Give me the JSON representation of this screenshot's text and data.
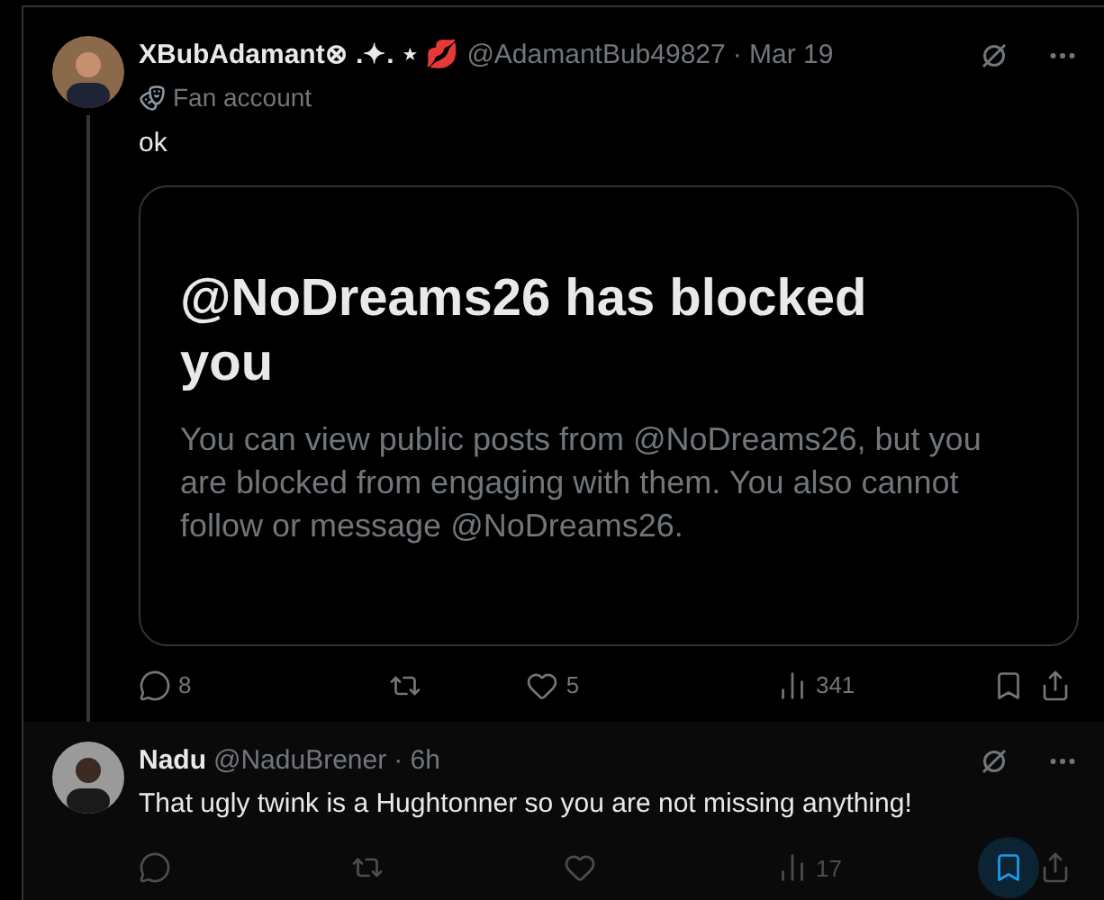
{
  "post": {
    "display_name": "XBubAdamant⊗ .✦. ⋆ 💋",
    "handle": "@AdamantBub49827",
    "time": "· Mar 19",
    "label": "Fan account",
    "text": "ok",
    "notice": {
      "title": "@NoDreams26 has blocked you",
      "body": "You can view public posts from @NoDreams26, but you are blocked from engaging with them. You also cannot follow or message @NoDreams26."
    },
    "actions": [
      {
        "kind": "reply",
        "count": "8",
        "highlighted": false
      },
      {
        "kind": "repost",
        "highlighted": false
      },
      {
        "kind": "like",
        "count": "5",
        "highlighted": false
      },
      {
        "kind": "views",
        "count": "341",
        "highlighted": false
      },
      {
        "kind": "bookmark",
        "highlighted": false
      },
      {
        "kind": "share",
        "highlighted": false
      }
    ]
  },
  "reply": {
    "display_name": "Nadu",
    "handle": "@NaduBrener",
    "time": "· 6h",
    "text": "That ugly twink is a Hughtonner so you are not missing anything!",
    "actions": [
      {
        "kind": "reply",
        "highlighted": false
      },
      {
        "kind": "repost",
        "highlighted": false
      },
      {
        "kind": "like",
        "highlighted": false
      },
      {
        "kind": "views",
        "count": "17",
        "highlighted": false
      },
      {
        "kind": "bookmark",
        "highlighted": true
      },
      {
        "kind": "share",
        "highlighted": false
      }
    ]
  }
}
